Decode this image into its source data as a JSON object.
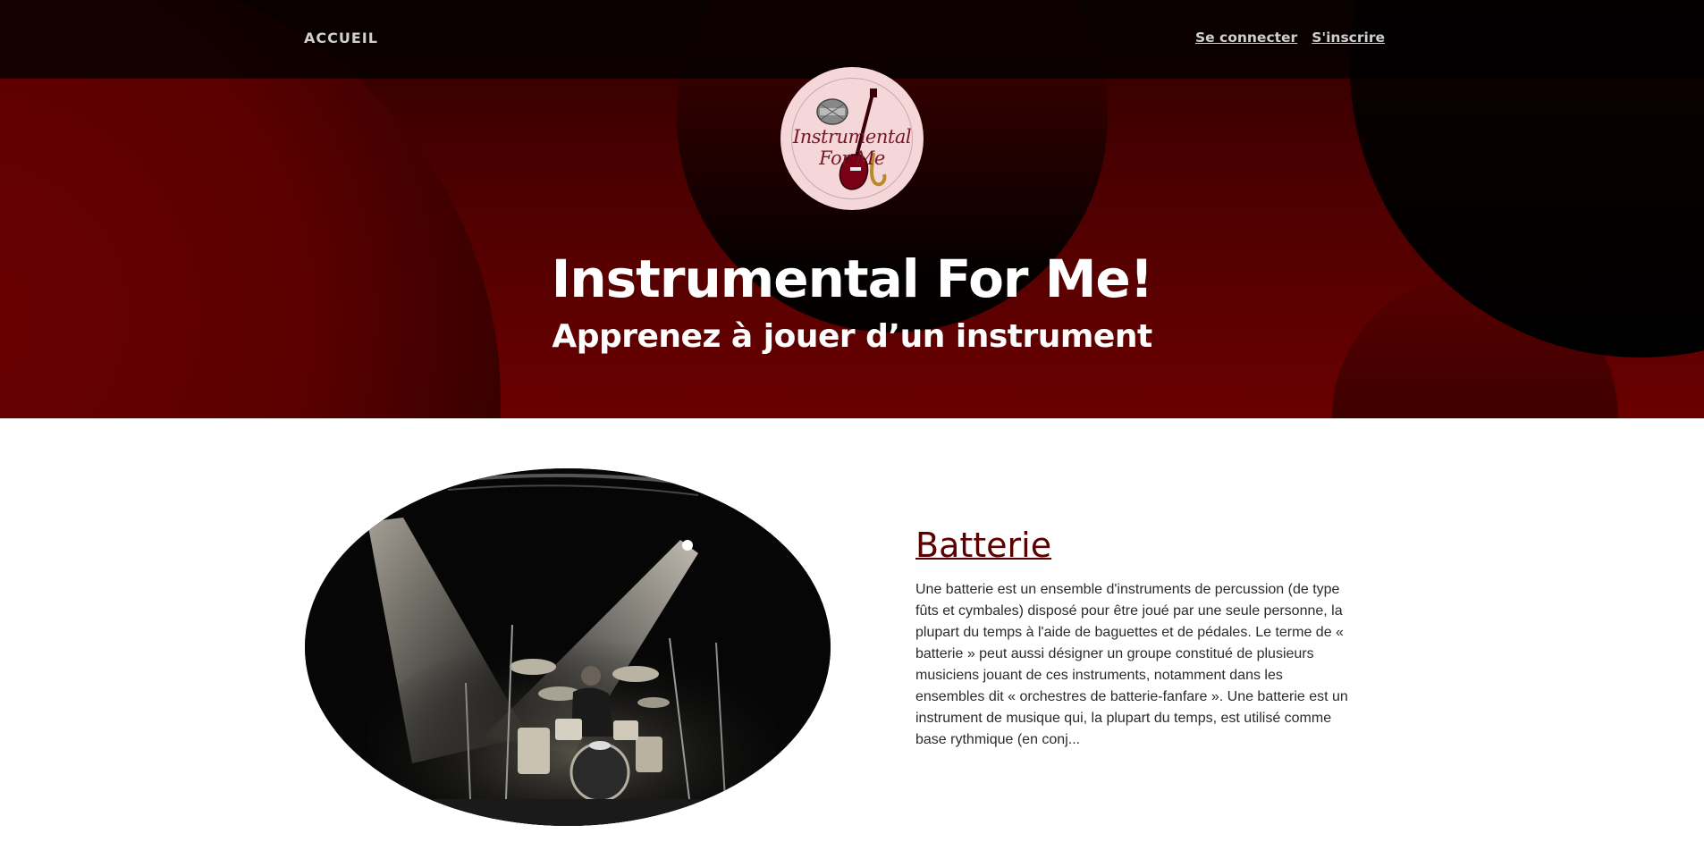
{
  "nav": {
    "home": "ACCUEIL",
    "login": "Se connecter",
    "signup": "S'inscrire"
  },
  "logo": {
    "text": "Instrumental For Me"
  },
  "hero": {
    "title": "Instrumental For Me!",
    "subtitle": "Apprenez à jouer d’un instrument"
  },
  "article": {
    "title": "Batterie",
    "excerpt": "Une batterie est un ensemble d'instruments de percussion (de type fûts et cymbales) disposé pour être joué par une seule personne, la plupart du temps à l'aide de baguettes et de pédales. Le terme de « batterie » peut aussi désigner un groupe constitué de plusieurs musiciens jouant de ces instruments, notamment dans les ensembles dit « orchestres de batterie-fanfare ». Une batterie est un instrument de musique qui, la plupart du temps, est utilisé comme base rythmique (en conj..."
  },
  "colors": {
    "brand_dark_red": "#5a0000",
    "hero_red": "#6a0000",
    "navbar_bg": "#000000"
  }
}
